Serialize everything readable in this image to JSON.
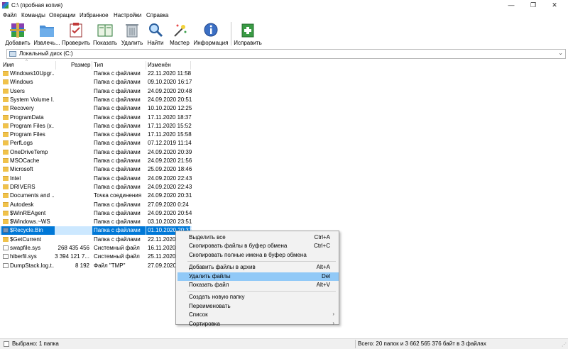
{
  "window": {
    "title": "C:\\ (пробная копия)",
    "minimize": "—",
    "maximize": "❐",
    "close": "✕"
  },
  "menu": [
    "Файл",
    "Команды",
    "Операции",
    "Избранное",
    "Настройки",
    "Справка"
  ],
  "toolbar": [
    {
      "label": "Добавить",
      "icon": "archive-add-icon"
    },
    {
      "label": "Извлечь...",
      "icon": "extract-folder-icon"
    },
    {
      "label": "Проверить",
      "icon": "test-clipboard-icon"
    },
    {
      "label": "Показать",
      "icon": "view-book-icon"
    },
    {
      "label": "Удалить",
      "icon": "trash-icon"
    },
    {
      "label": "Найти",
      "icon": "magnifier-icon"
    },
    {
      "label": "Мастер",
      "icon": "wizard-wand-icon"
    },
    {
      "label": "Информация",
      "icon": "info-icon"
    },
    {
      "label": "Исправить",
      "icon": "repair-kit-icon"
    }
  ],
  "address": {
    "path": "Локальный диск (C:)",
    "dropdown": "⌄"
  },
  "columns": {
    "name": "Имя",
    "size": "Размер",
    "type": "Тип",
    "modified": "Изменён"
  },
  "files": [
    {
      "name": "Windows10Upgr...",
      "size": "",
      "type": "Папка с файлами",
      "modified": "22.11.2020 11:58",
      "kind": "folder"
    },
    {
      "name": "Windows",
      "size": "",
      "type": "Папка с файлами",
      "modified": "09.10.2020 16:17",
      "kind": "folder"
    },
    {
      "name": "Users",
      "size": "",
      "type": "Папка с файлами",
      "modified": "24.09.2020 20:48",
      "kind": "folder"
    },
    {
      "name": "System Volume I...",
      "size": "",
      "type": "Папка с файлами",
      "modified": "24.09.2020 20:51",
      "kind": "folder"
    },
    {
      "name": "Recovery",
      "size": "",
      "type": "Папка с файлами",
      "modified": "10.10.2020 12:25",
      "kind": "folder"
    },
    {
      "name": "ProgramData",
      "size": "",
      "type": "Папка с файлами",
      "modified": "17.11.2020 18:37",
      "kind": "folder"
    },
    {
      "name": "Program Files (x...",
      "size": "",
      "type": "Папка с файлами",
      "modified": "17.11.2020 15:52",
      "kind": "folder"
    },
    {
      "name": "Program Files",
      "size": "",
      "type": "Папка с файлами",
      "modified": "17.11.2020 15:58",
      "kind": "folder"
    },
    {
      "name": "PerfLogs",
      "size": "",
      "type": "Папка с файлами",
      "modified": "07.12.2019 11:14",
      "kind": "folder"
    },
    {
      "name": "OneDriveTemp",
      "size": "",
      "type": "Папка с файлами",
      "modified": "24.09.2020 20:39",
      "kind": "folder"
    },
    {
      "name": "MSOCache",
      "size": "",
      "type": "Папка с файлами",
      "modified": "24.09.2020 21:56",
      "kind": "folder"
    },
    {
      "name": "Microsoft",
      "size": "",
      "type": "Папка с файлами",
      "modified": "25.09.2020 18:46",
      "kind": "folder"
    },
    {
      "name": "Intel",
      "size": "",
      "type": "Папка с файлами",
      "modified": "24.09.2020 22:43",
      "kind": "folder"
    },
    {
      "name": "DRIVERS",
      "size": "",
      "type": "Папка с файлами",
      "modified": "24.09.2020 22:43",
      "kind": "folder"
    },
    {
      "name": "Documents and ...",
      "size": "",
      "type": "Точка соединения",
      "modified": "24.09.2020 20:31",
      "kind": "folder"
    },
    {
      "name": "Autodesk",
      "size": "",
      "type": "Папка с файлами",
      "modified": "27.09.2020 0:24",
      "kind": "folder"
    },
    {
      "name": "$WinREAgent",
      "size": "",
      "type": "Папка с файлами",
      "modified": "24.09.2020 20:54",
      "kind": "folder"
    },
    {
      "name": "$Windows.~WS",
      "size": "",
      "type": "Папка с файлами",
      "modified": "03.10.2020 23:51",
      "kind": "folder"
    },
    {
      "name": "$Recycle.Bin",
      "size": "",
      "type": "Папка с файлами",
      "modified": "01.10.2020 20:37",
      "kind": "recycle"
    },
    {
      "name": "$GetCurrent",
      "size": "",
      "type": "Папка с файлами",
      "modified": "22.11.2020 1",
      "kind": "folder"
    },
    {
      "name": "swapfile.sys",
      "size": "268 435 456",
      "type": "Системный файл",
      "modified": "16.11.2020 8",
      "kind": "sysfile"
    },
    {
      "name": "hiberfil.sys",
      "size": "3 394 121 7...",
      "type": "Системный файл",
      "modified": "25.11.2020",
      "kind": "sysfile"
    },
    {
      "name": "DumpStack.log.t...",
      "size": "8 192",
      "type": "Файл \"TMP\"",
      "modified": "27.09.2020 1",
      "kind": "sysfile"
    }
  ],
  "context_menu": {
    "groups": [
      [
        {
          "label": "Выделить все",
          "shortcut": "Ctrl+A"
        },
        {
          "label": "Скопировать файлы в буфер обмена",
          "shortcut": "Ctrl+C"
        },
        {
          "label": "Скопировать полные имена в буфер обмена",
          "shortcut": ""
        }
      ],
      [
        {
          "label": "Добавить файлы в архив",
          "shortcut": "Alt+A"
        },
        {
          "label": "Удалить файлы",
          "shortcut": "Del",
          "highlighted": true
        },
        {
          "label": "Показать файл",
          "shortcut": "Alt+V"
        }
      ],
      [
        {
          "label": "Создать новую папку",
          "shortcut": ""
        },
        {
          "label": "Переименовать",
          "shortcut": ""
        },
        {
          "label": "Список",
          "shortcut": "",
          "submenu": true
        },
        {
          "label": "Сортировка",
          "shortcut": "",
          "submenu": true
        }
      ]
    ]
  },
  "status": {
    "left": "Выбрано: 1 папка",
    "right": "Всего: 20 папок и 3 662 565 376 байт в 3 файлах"
  },
  "colors": {
    "selection": "#0078d7",
    "menu_highlight": "#91c9f7",
    "folder": "#f0c24b"
  }
}
